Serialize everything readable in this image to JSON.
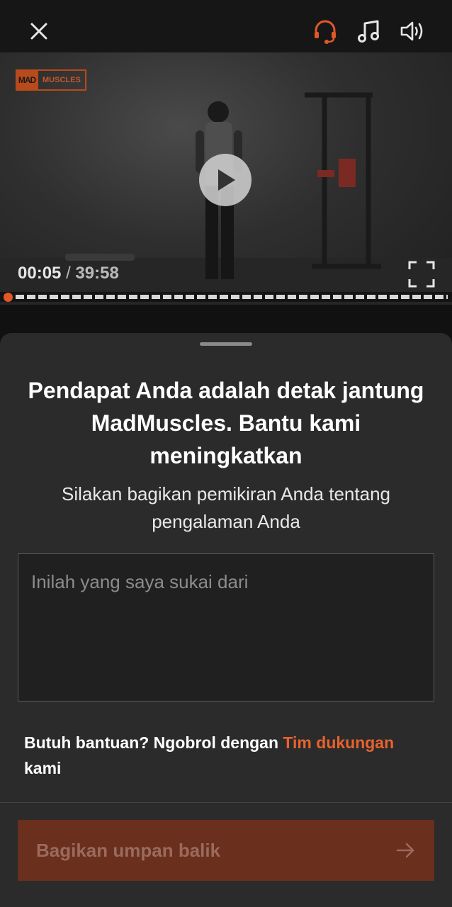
{
  "player": {
    "logo": {
      "mad": "MAD",
      "muscles": "MUSCLES"
    },
    "time": {
      "current": "00:05",
      "separator": "/",
      "total": "39:58"
    },
    "progress": 0.002,
    "icons": {
      "close": "close-icon",
      "support": "headset-icon",
      "music": "music-note-icon",
      "sound": "speaker-icon",
      "play": "play-icon",
      "fullscreen": "fullscreen-icon"
    }
  },
  "sheet": {
    "title": "Pendapat Anda adalah detak jantung MadMuscles. Bantu kami meningkatkan",
    "subtitle": "Silakan bagikan pemikiran Anda tentang pengalaman Anda",
    "input": {
      "placeholder": "Inilah yang saya sukai dari",
      "value": ""
    },
    "help": {
      "prefix": "Butuh bantuan? Ngobrol dengan ",
      "link": "Tim dukungan",
      "suffix": " kami"
    },
    "submit": {
      "label": "Bagikan umpan balik",
      "icon": "arrow-right-icon"
    }
  },
  "colors": {
    "accent": "#e2572a",
    "background": "#111111",
    "sheet": "#2b2b2b",
    "button_disabled": "#6a2f1d"
  }
}
